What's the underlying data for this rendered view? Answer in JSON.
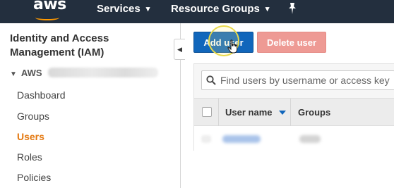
{
  "topbar": {
    "logo_text": "aws",
    "services_label": "Services",
    "resource_groups_label": "Resource Groups",
    "caret": "▾",
    "pin_icon": "pin-icon"
  },
  "sidebar": {
    "title": "Identity and Access Management (IAM)",
    "account_label": "AWS",
    "account_toggle": "▼",
    "items": [
      {
        "label": "Dashboard",
        "active": false
      },
      {
        "label": "Groups",
        "active": false
      },
      {
        "label": "Users",
        "active": true
      },
      {
        "label": "Roles",
        "active": false
      },
      {
        "label": "Policies",
        "active": false
      }
    ],
    "collapse_glyph": "◀"
  },
  "toolbar": {
    "add_user_label": "Add user",
    "delete_user_label": "Delete user"
  },
  "search": {
    "placeholder": "Find users by username or access key",
    "value": ""
  },
  "table": {
    "columns": [
      "User name",
      "Groups"
    ],
    "sort_column": "User name",
    "sort_direction": "descending"
  },
  "colors": {
    "nav_background": "#232f3e",
    "brand_orange": "#ff9900",
    "primary_button": "#1166bb",
    "danger_button_disabled": "#ee9a94",
    "active_link": "#e47911"
  }
}
